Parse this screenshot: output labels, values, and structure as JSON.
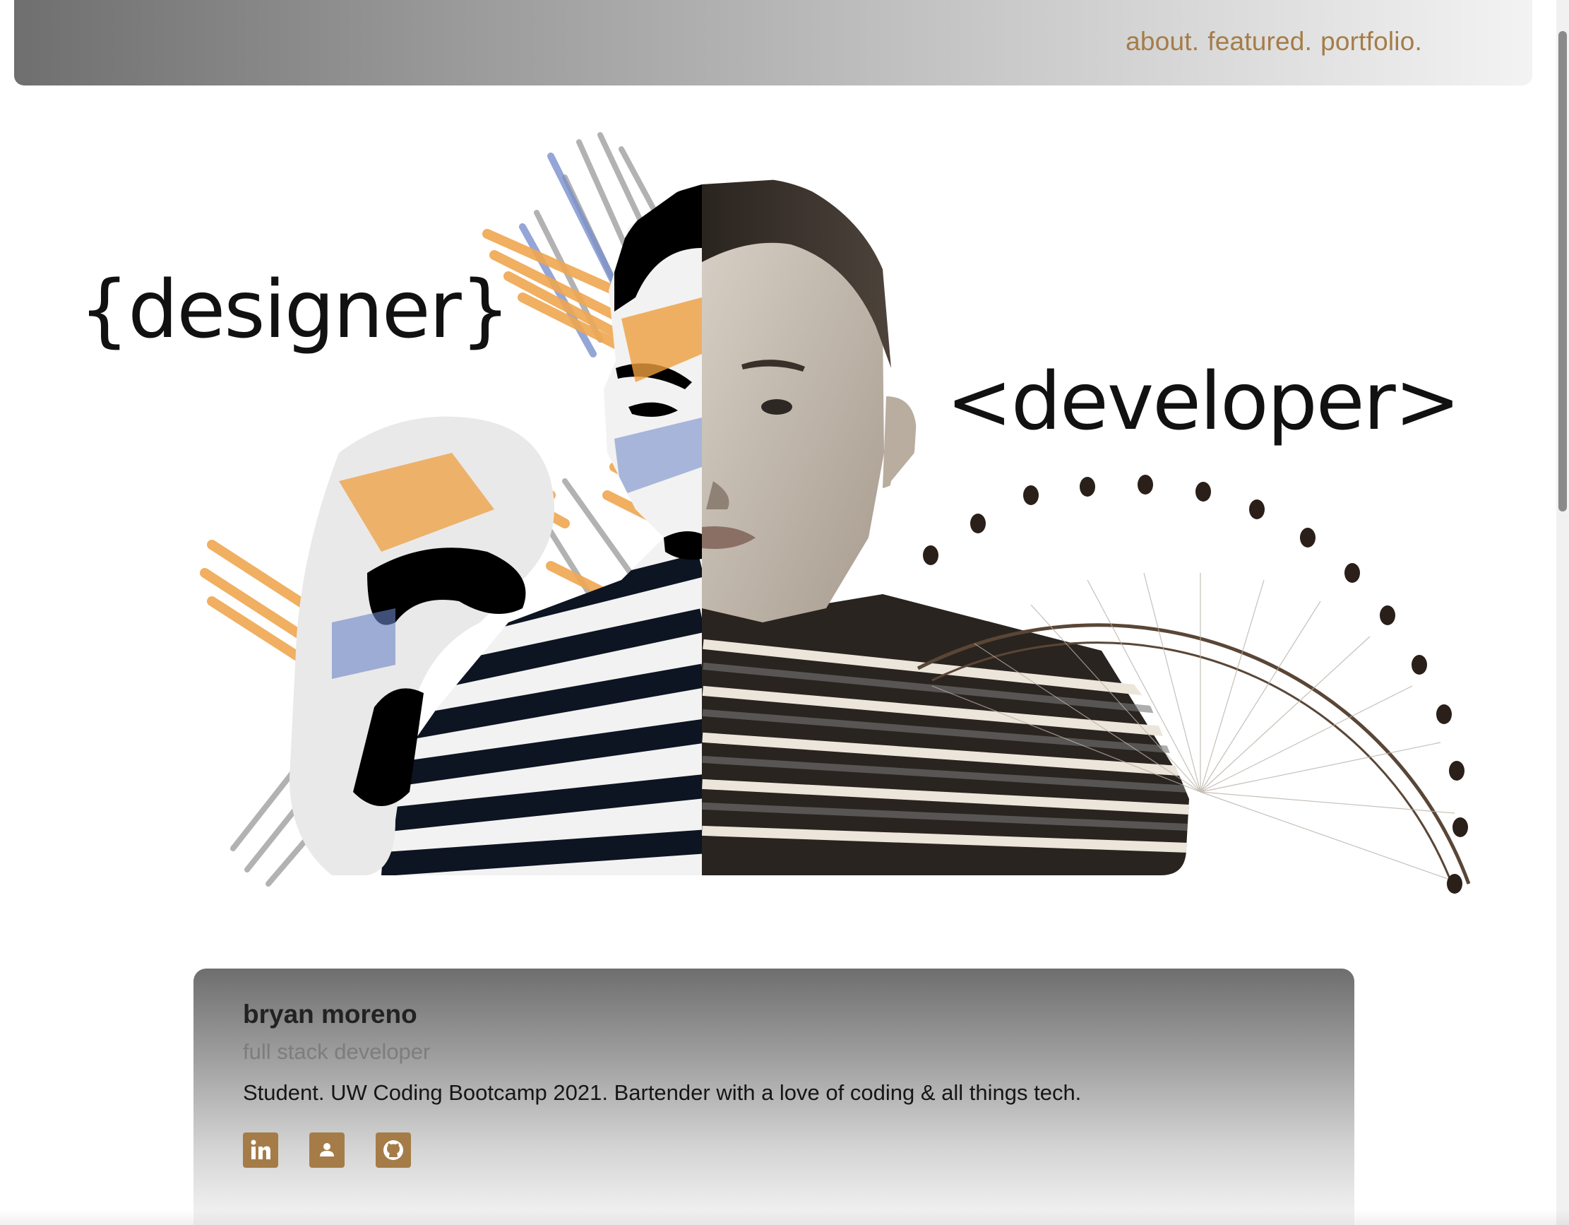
{
  "nav": {
    "links": [
      "about.",
      "featured.",
      "portfolio."
    ]
  },
  "hero": {
    "left_label": "{designer}",
    "right_label": "<developer>"
  },
  "profile": {
    "name": "bryan moreno",
    "role": "full stack developer",
    "bio": "Student. UW Coding Bootcamp 2021. Bartender with a love of coding & all things tech.",
    "icons": [
      "linkedin-icon",
      "contact-card-icon",
      "github-icon"
    ]
  },
  "colors": {
    "accent": "#a57c48",
    "text": "#161616",
    "muted": "#7d7d7d",
    "orange_paint": "#ee9d3d",
    "blue_paint": "#6b84c6",
    "wheel": "#5a4636"
  }
}
